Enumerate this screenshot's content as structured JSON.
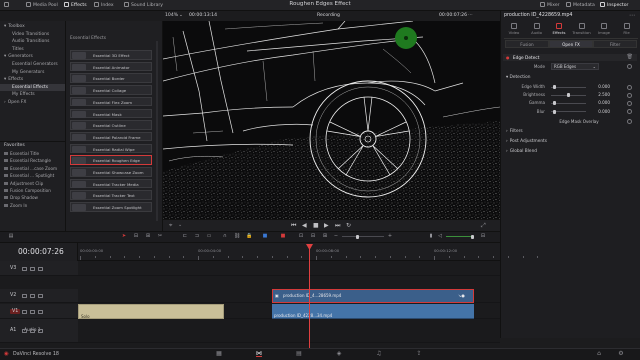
{
  "topbar": {
    "left_items": [
      {
        "label": "Media Pool",
        "icon": "media-pool-icon"
      },
      {
        "label": "Effects",
        "icon": "effects-icon",
        "active": true
      },
      {
        "label": "Index",
        "icon": "index-icon"
      },
      {
        "label": "Sound Library",
        "icon": "sound-library-icon"
      }
    ],
    "title": "Roughen Edges Effect",
    "right_items": [
      {
        "label": "Mixer",
        "icon": "mixer-icon"
      },
      {
        "label": "Metadata",
        "icon": "metadata-icon"
      },
      {
        "label": "Inspector",
        "icon": "inspector-icon",
        "active": true
      }
    ]
  },
  "viewer": {
    "zoom": "104%",
    "timecode_left": "00:00:13:14",
    "mode": "Recording",
    "timecode_right": "00:00:07:26"
  },
  "left_panel": {
    "tree": [
      {
        "label": "Toolbox",
        "indent": 0,
        "chevron": "▾"
      },
      {
        "label": "Video Transitions",
        "indent": 1
      },
      {
        "label": "Audio Transitions",
        "indent": 1
      },
      {
        "label": "Titles",
        "indent": 1
      },
      {
        "label": "Generators",
        "indent": 0,
        "chevron": "▾"
      },
      {
        "label": "Essential Generators",
        "indent": 1
      },
      {
        "label": "My Generators",
        "indent": 1
      },
      {
        "label": "Effects",
        "indent": 0,
        "chevron": "▾"
      },
      {
        "label": "Essential Effects",
        "indent": 1,
        "selected": true
      },
      {
        "label": "My Effects",
        "indent": 1
      },
      {
        "label": "Open FX",
        "indent": 0,
        "chevron": "›"
      }
    ],
    "favorites_title": "Favorites",
    "favorites": [
      "Essential Title",
      "Essential Rectangle",
      "Essential ...case Zoom",
      "Essential ... Spotlight",
      "Adjustment Clip",
      "Fusion Composition",
      "Drop Shadow",
      "Zoom In"
    ],
    "list_title": "Essential Effects",
    "effects": [
      {
        "label": "Essential 3D Effect"
      },
      {
        "label": "Essential Animator"
      },
      {
        "label": "Essential Border"
      },
      {
        "label": "Essential Collage"
      },
      {
        "label": "Essential Flex Zoom"
      },
      {
        "label": "Essential Mask"
      },
      {
        "label": "Essential Outline"
      },
      {
        "label": "Essential Polaroid Frame"
      },
      {
        "label": "Essential Radial Wipe"
      },
      {
        "label": "Essential Roughen Edge",
        "selected": true
      },
      {
        "label": "Essential Showcase Zoom"
      },
      {
        "label": "Essential Tracker Media"
      },
      {
        "label": "Essential Tracker Text"
      },
      {
        "label": "Essential Zoom Spotlight"
      }
    ]
  },
  "inspector": {
    "clip_name": "production ID_4228659.mp4",
    "tabs": [
      "Video",
      "Audio",
      "Effects",
      "Transition",
      "Image",
      "File"
    ],
    "active_tab": "Effects",
    "subtabs": [
      "Fusion",
      "Open FX",
      "Filter"
    ],
    "active_subtab": "Open FX",
    "effect_name": "Edge Detect",
    "mode_label": "Mode",
    "mode_value": "RGB Edges",
    "detection_label": "Detection",
    "params": [
      {
        "label": "Edge Width",
        "value": "0.000",
        "fraction": 0.05
      },
      {
        "label": "Brightness",
        "value": "2.500",
        "fraction": 0.5
      },
      {
        "label": "Gamma",
        "value": "0.000",
        "fraction": 0.05
      },
      {
        "label": "Blur",
        "value": "0.000",
        "fraction": 0.05
      }
    ],
    "overlay_label": "Edge Mask Overlay",
    "sections": [
      "Filters",
      "Post Adjustments",
      "Global Blend"
    ]
  },
  "timeline": {
    "timecode": "00:00:07:26",
    "ruler": [
      "00:00:00:00",
      "00:00:04:00",
      "00:00:08:00",
      "00:00:12:00"
    ],
    "tracks": [
      {
        "id": "V3",
        "label": ""
      },
      {
        "id": "V2",
        "label": ""
      },
      {
        "id": "V1",
        "label": ""
      },
      {
        "id": "A1",
        "label": "Audio 1"
      }
    ],
    "clips": [
      {
        "label": "production ID_4...28659.mp4"
      },
      {
        "label": "production ID_4228...34.mp4"
      },
      {
        "label": "Solo"
      }
    ]
  },
  "bottombar": {
    "app_name": "DaVinci Resolve 18"
  }
}
